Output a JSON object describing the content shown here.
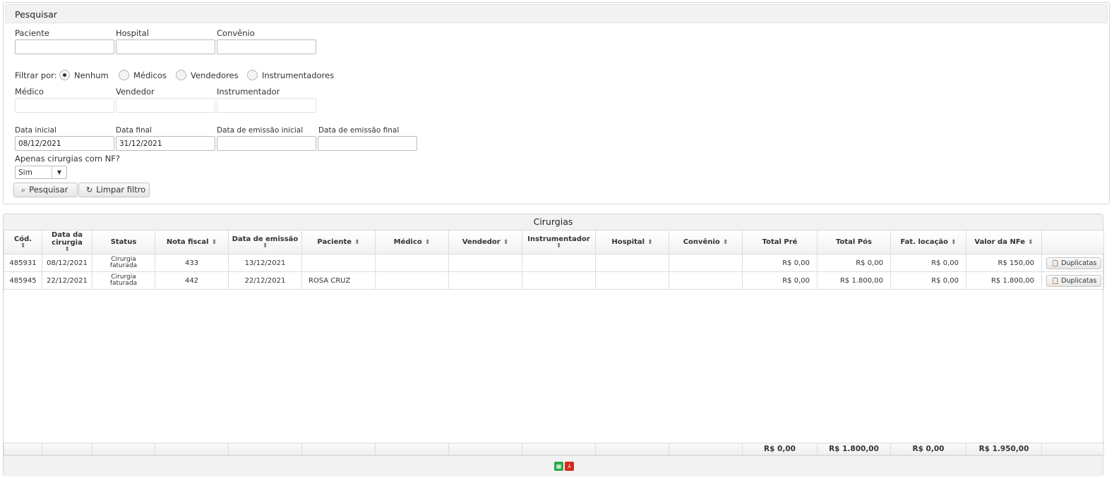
{
  "search": {
    "title": "Pesquisar",
    "fields": {
      "paciente": {
        "label": "Paciente",
        "value": ""
      },
      "hospital": {
        "label": "Hospital",
        "value": ""
      },
      "convenio": {
        "label": "Convênio",
        "value": ""
      }
    },
    "filter": {
      "label": "Filtrar por:",
      "options": [
        "Nenhum",
        "Médicos",
        "Vendedores",
        "Instrumentadores"
      ],
      "selected": "Nenhum"
    },
    "people": {
      "medico": {
        "label": "Médico",
        "value": ""
      },
      "vendedor": {
        "label": "Vendedor",
        "value": ""
      },
      "instrumentador": {
        "label": "Instrumentador",
        "value": ""
      }
    },
    "dates": {
      "data_inicial": {
        "label": "Data inicial",
        "value": "08/12/2021"
      },
      "data_final": {
        "label": "Data final",
        "value": "31/12/2021"
      },
      "emissao_inicial": {
        "label": "Data de emissão inicial",
        "value": ""
      },
      "emissao_final": {
        "label": "Data de emissão final",
        "value": ""
      }
    },
    "nf_only": {
      "label": "Apenas cirurgias com NF?",
      "value": "Sim"
    },
    "buttons": {
      "search": "Pesquisar",
      "clear": "Limpar filtro"
    }
  },
  "grid": {
    "title": "Cirurgias",
    "columns": [
      "Cód.",
      "Data da cirurgia",
      "Status",
      "Nota fiscal",
      "Data de emissão",
      "Paciente",
      "Médico",
      "Vendedor",
      "Instrumentador",
      "Hospital",
      "Convênio",
      "Total Pré",
      "Total Pós",
      "Fat. locação",
      "Valor da NFe",
      ""
    ],
    "rows": [
      {
        "cod": "485931",
        "data": "08/12/2021",
        "status": "Cirurgia faturada",
        "nf": "433",
        "emissao": "13/12/2021",
        "paciente": "",
        "medico": "",
        "vendedor": "",
        "instrumentador": "",
        "hospital": "",
        "convenio": "",
        "pre": "R$ 0,00",
        "pos": "R$ 0,00",
        "locacao": "R$ 0,00",
        "nfe": "R$ 150,00",
        "action": "Duplicatas"
      },
      {
        "cod": "485945",
        "data": "22/12/2021",
        "status": "Cirurgia faturada",
        "nf": "442",
        "emissao": "22/12/2021",
        "paciente": "ROSA CRUZ",
        "medico": "",
        "vendedor": "",
        "instrumentador": "",
        "hospital": "",
        "convenio": "",
        "pre": "R$ 0,00",
        "pos": "R$ 1.800,00",
        "locacao": "R$ 0,00",
        "nfe": "R$ 1.800,00",
        "action": "Duplicatas"
      }
    ],
    "totals": {
      "pre": "R$ 0,00",
      "pos": "R$ 1.800,00",
      "locacao": "R$ 0,00",
      "nfe": "R$ 1.950,00"
    },
    "export": {
      "excel_icon": "spreadsheet-icon",
      "pdf_icon": "pdf-icon",
      "excel_color": "#2aa84a",
      "pdf_color": "#d52b1e"
    }
  }
}
